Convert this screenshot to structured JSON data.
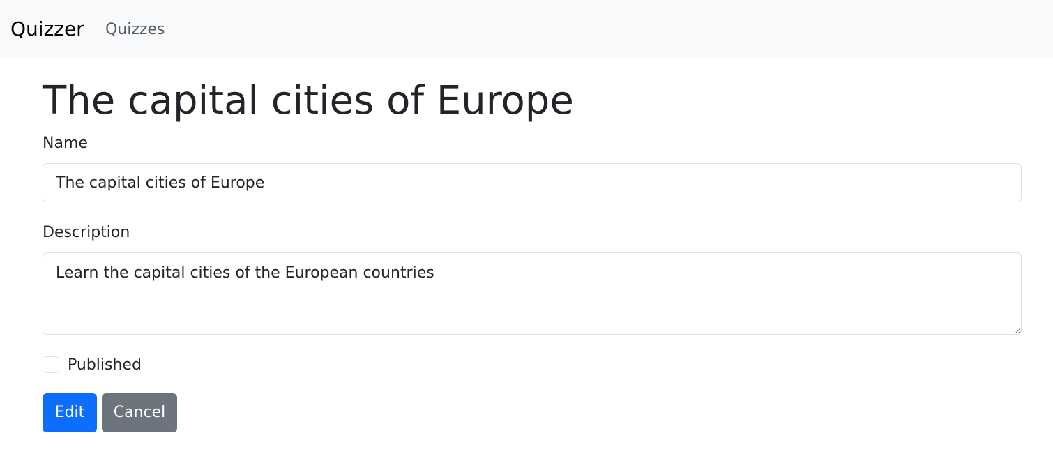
{
  "navbar": {
    "brand": "Quizzer",
    "links": [
      {
        "label": "Quizzes"
      }
    ]
  },
  "page": {
    "title": "The capital cities of Europe"
  },
  "form": {
    "name": {
      "label": "Name",
      "value": "The capital cities of Europe"
    },
    "description": {
      "label": "Description",
      "value": "Learn the capital cities of the European countries"
    },
    "published": {
      "label": "Published",
      "checked": false
    },
    "buttons": {
      "edit": "Edit",
      "cancel": "Cancel"
    }
  },
  "colors": {
    "navbar_bg": "#f8f9fa",
    "primary": "#0d6efd",
    "secondary": "#6c757d",
    "border": "#dee2e6",
    "text": "#212529"
  }
}
